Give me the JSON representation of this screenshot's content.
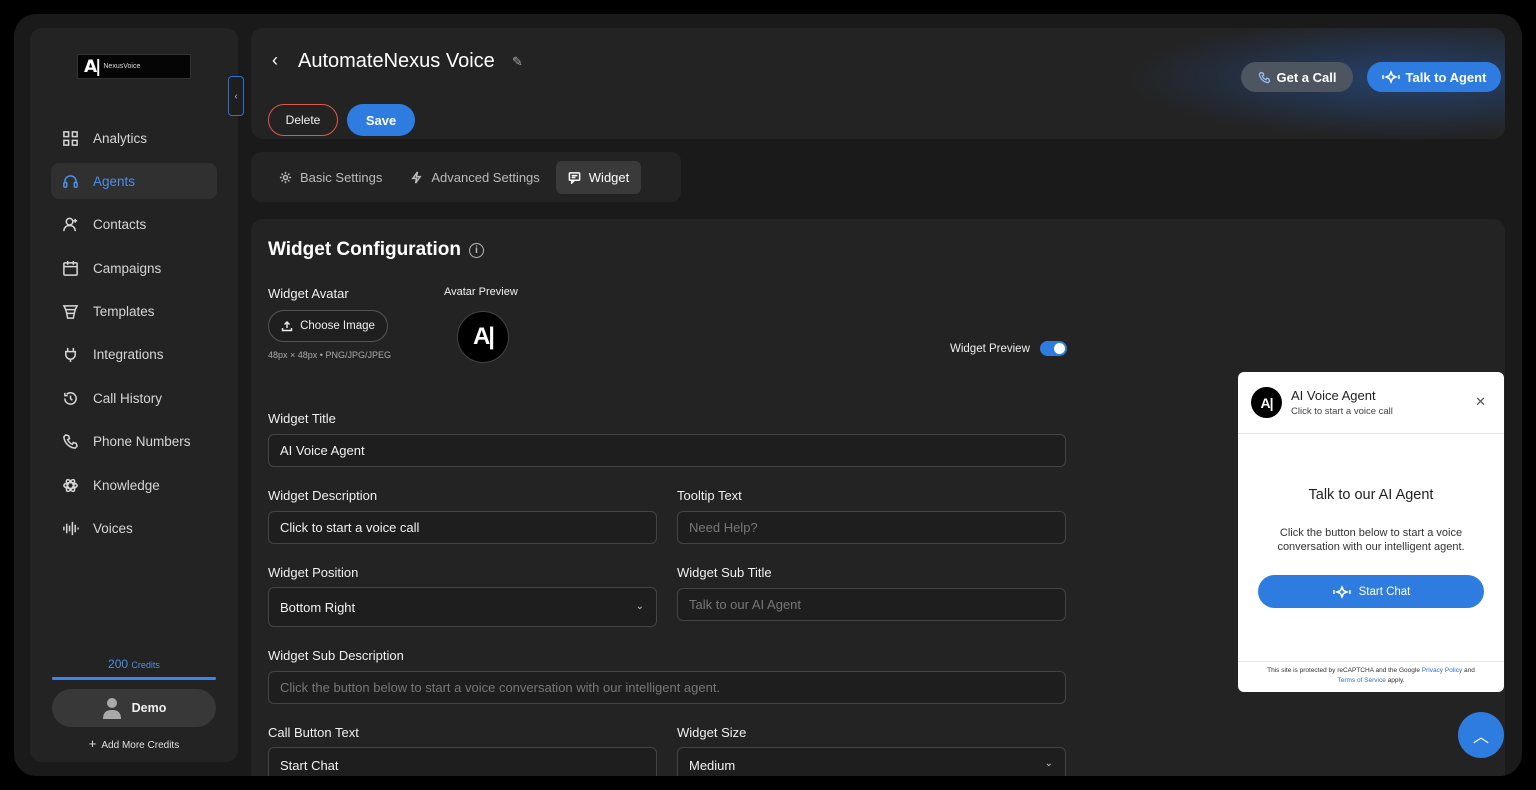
{
  "sidebar": {
    "logo_text": "NexusVoice",
    "collapse_icon": "chevron-left-icon",
    "items": [
      {
        "label": "Analytics",
        "icon": "grid-icon"
      },
      {
        "label": "Agents",
        "icon": "headset-icon",
        "active": true
      },
      {
        "label": "Contacts",
        "icon": "user-plus-icon"
      },
      {
        "label": "Campaigns",
        "icon": "calendar-icon"
      },
      {
        "label": "Templates",
        "icon": "layers-icon"
      },
      {
        "label": "Integrations",
        "icon": "plug-icon"
      },
      {
        "label": "Call History",
        "icon": "history-icon"
      },
      {
        "label": "Phone Numbers",
        "icon": "phone-icon"
      },
      {
        "label": "Knowledge",
        "icon": "atom-icon"
      },
      {
        "label": "Voices",
        "icon": "waveform-icon"
      }
    ],
    "credits_value": "200",
    "credits_unit": "Credits",
    "user_name": "Demo",
    "add_credits": "Add More Credits"
  },
  "header": {
    "title": "AutomateNexus Voice",
    "delete_label": "Delete",
    "save_label": "Save",
    "get_call_label": "Get a Call",
    "talk_label": "Talk to Agent"
  },
  "tabs": [
    {
      "label": "Basic Settings",
      "icon": "gear-icon"
    },
    {
      "label": "Advanced Settings",
      "icon": "bolt-icon"
    },
    {
      "label": "Widget",
      "icon": "chat-icon",
      "active": true
    }
  ],
  "form": {
    "section_title": "Widget Configuration",
    "avatar_label": "Widget Avatar",
    "avatar_preview_label": "Avatar Preview",
    "choose_image": "Choose Image",
    "avatar_hint": "48px × 48px • PNG/JPG/JPEG",
    "widget_preview_label": "Widget Preview",
    "widget_preview_on": true,
    "title_label": "Widget Title",
    "title_value": "AI Voice Agent",
    "description_label": "Widget Description",
    "description_value": "Click to start a voice call",
    "tooltip_label": "Tooltip Text",
    "tooltip_placeholder": "Need Help?",
    "position_label": "Widget Position",
    "position_value": "Bottom Right",
    "subtitle_label": "Widget Sub Title",
    "subtitle_placeholder": "Talk to our AI Agent",
    "subdesc_label": "Widget Sub Description",
    "subdesc_placeholder": "Click the button below to start a voice conversation with our intelligent agent.",
    "call_button_label": "Call Button Text",
    "call_button_value": "Start Chat",
    "size_label": "Widget Size",
    "size_value": "Medium"
  },
  "preview": {
    "title": "AI Voice Agent",
    "subtitle": "Click to start a voice call",
    "heading": "Talk to our AI Agent",
    "description": "Click the button below to start a voice conversation with our intelligent agent.",
    "button": "Start Chat",
    "footer_pre": "This site is protected by reCAPTCHA and the Google",
    "footer_privacy": "Privacy Policy",
    "footer_and": "and",
    "footer_terms": "Terms of Service",
    "footer_post": "apply."
  },
  "colors": {
    "accent": "#2f7ce0",
    "danger": "#e0564a",
    "background": "#1a1a1a",
    "panel": "#232323"
  }
}
